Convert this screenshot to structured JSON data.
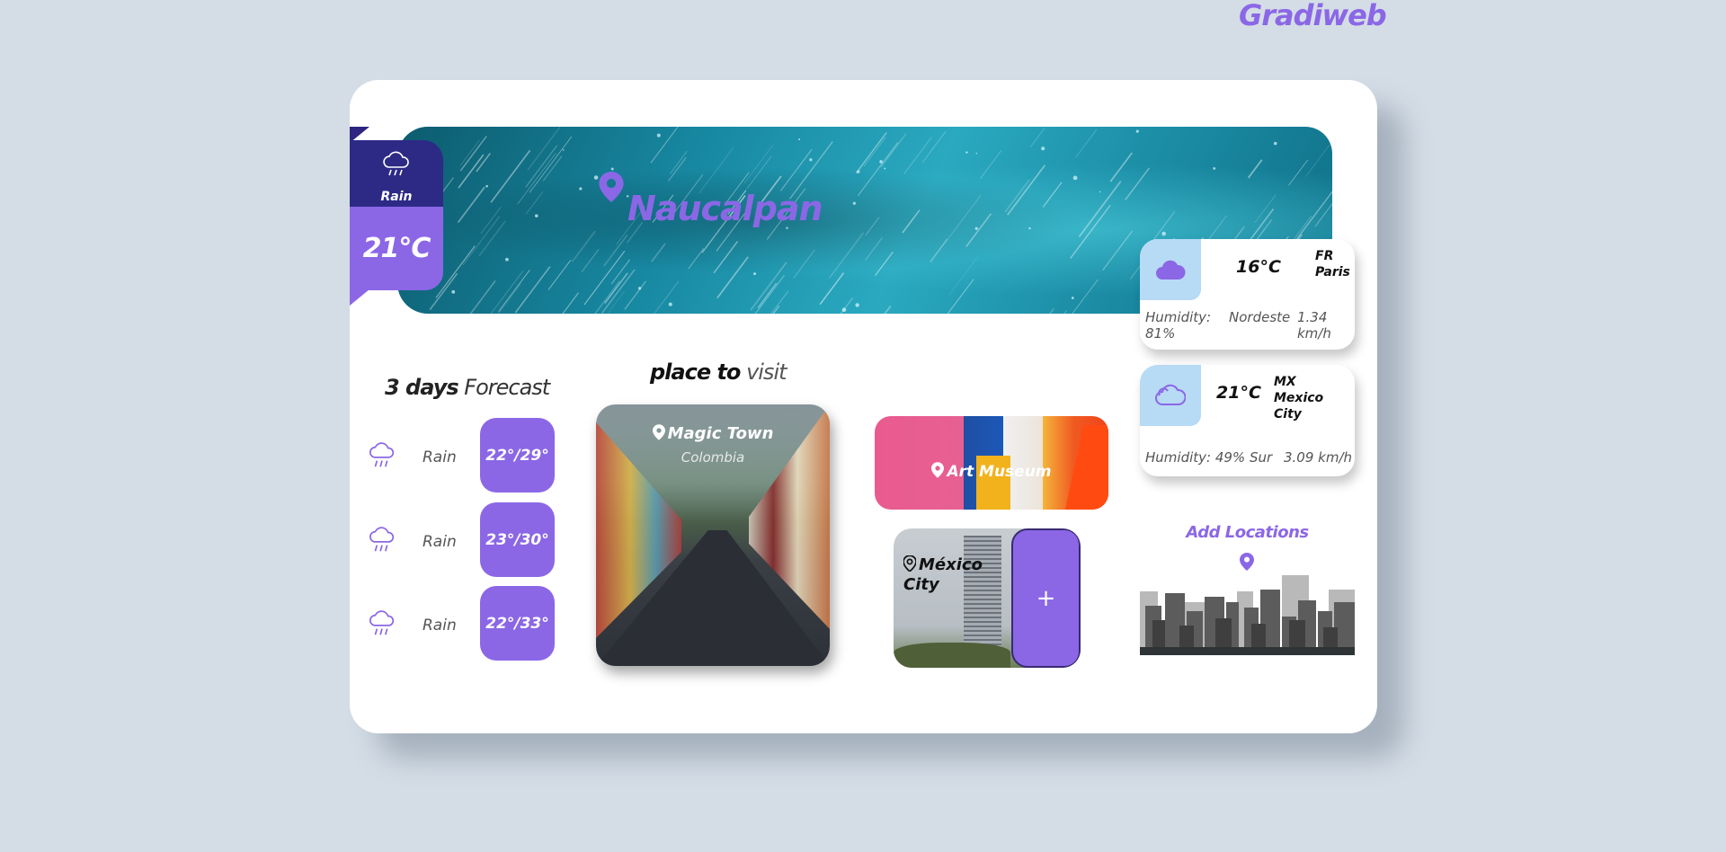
{
  "brand": "Gradiweb",
  "hero": {
    "city": "Naucalpan",
    "condition": "Rain",
    "temperature": "21°C"
  },
  "forecast": {
    "title_bold": "3 days",
    "title_light": "Forecast",
    "days": [
      {
        "icon": "rain-cloud-icon",
        "condition": "Rain",
        "range": "22°/29°"
      },
      {
        "icon": "rain-cloud-icon",
        "condition": "Rain",
        "range": "23°/30°"
      },
      {
        "icon": "rain-cloud-icon",
        "condition": "Rain",
        "range": "22°/33°"
      }
    ]
  },
  "places": {
    "title_bold": "place to",
    "title_light": "visit",
    "items": [
      {
        "name": "Magic Town",
        "country": "Colombia"
      },
      {
        "name": "Art Museum"
      },
      {
        "name_line1": "México",
        "name_line2": "City",
        "action": "+"
      }
    ]
  },
  "cities": [
    {
      "icon": "cloud-icon",
      "temp": "16°C",
      "country": "FR",
      "city": "Paris",
      "humidity": "Humidity: 81%",
      "wind_dir": "Nordeste",
      "wind_speed": "1.34 km/h"
    },
    {
      "icon": "cloud-outline-icon",
      "temp": "21°C",
      "country": "MX",
      "city": "Mexico City",
      "humidity": "Humidity: 49%",
      "wind_dir": "Sur",
      "wind_speed": "3.09 km/h"
    }
  ],
  "add_locations": "Add Locations",
  "colors": {
    "accent": "#8b67e6",
    "navy": "#2d2a86",
    "background": "#d4dde6",
    "icon_box": "#b7daf5"
  }
}
